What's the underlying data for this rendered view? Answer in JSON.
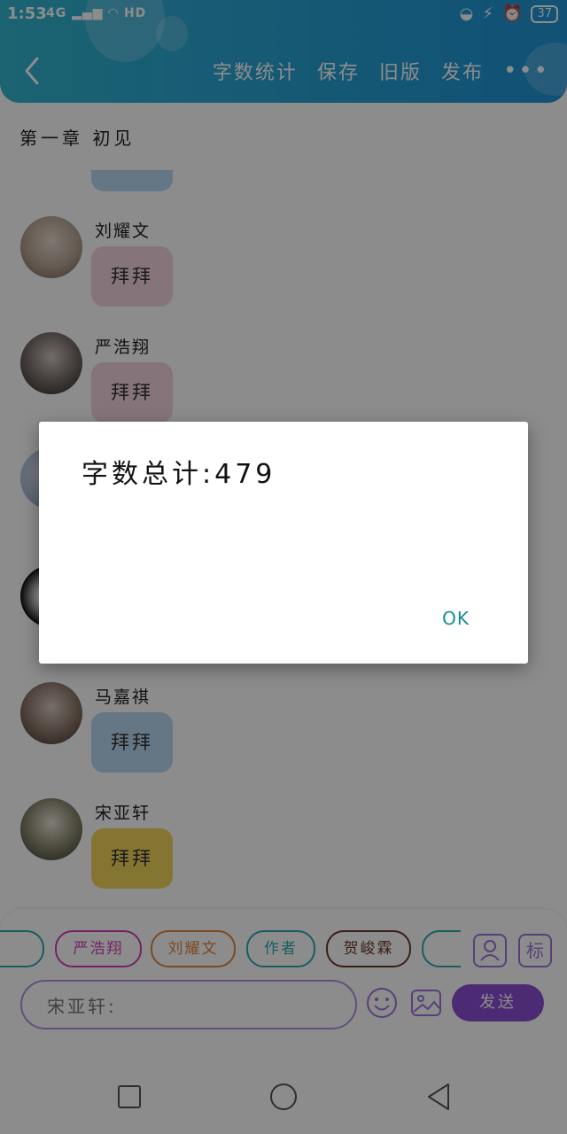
{
  "status_bar": {
    "time": "1:53",
    "network": "4G",
    "hd": "HD",
    "battery": "37"
  },
  "header": {
    "back_icon": "chevron-left-icon",
    "actions": [
      "字数统计",
      "保存",
      "旧版",
      "发布"
    ],
    "more": "•••"
  },
  "chapter_title": "第一章  初见",
  "messages": [
    {
      "name": "刘耀文",
      "text": "拜拜",
      "bubble_color": "#f3d6de"
    },
    {
      "name": "严浩翔",
      "text": "拜拜",
      "bubble_color": "#f3d6de"
    },
    {
      "name": "马嘉祺",
      "text": "拜拜",
      "bubble_color": "#b8d8f2"
    },
    {
      "name": "宋亚轩",
      "text": "拜拜",
      "bubble_color": "#f2d65c"
    }
  ],
  "composer": {
    "chips": [
      {
        "label": "严浩翔",
        "color": "#d43fb8"
      },
      {
        "label": "刘耀文",
        "color": "#e0883e"
      },
      {
        "label": "作者",
        "color": "#2fa9b3"
      },
      {
        "label": "贺峻霖",
        "color": "#6b3a2a"
      }
    ],
    "tag_tool": "标",
    "input_value": "宋亚轩:",
    "send_label": "发送",
    "accent": "#8c4fd3"
  },
  "dialog": {
    "message": "字数总计:479",
    "ok_label": "OK"
  }
}
